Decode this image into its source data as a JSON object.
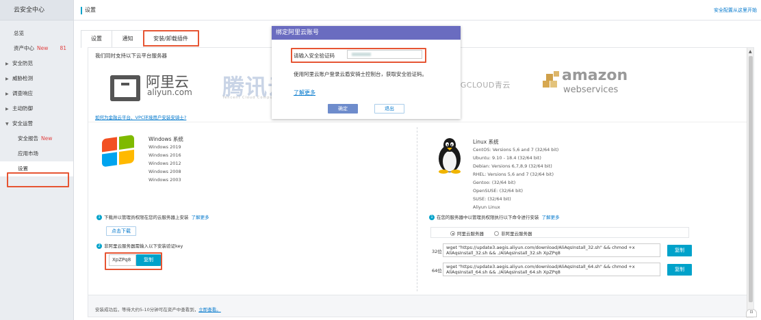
{
  "sidebar": {
    "brand": "云安全中心",
    "items": [
      {
        "label": "总览"
      },
      {
        "label": "资产中心",
        "badge": "New",
        "count": "81"
      },
      {
        "label": "安全防范",
        "group": true
      },
      {
        "label": "威胁检测",
        "group": true
      },
      {
        "label": "调查响应",
        "group": true
      },
      {
        "label": "主动防御",
        "group": true
      },
      {
        "label": "安全运营",
        "group": true,
        "expanded": true
      },
      {
        "label": "安全报告",
        "badge": "New",
        "sub": true
      },
      {
        "label": "应用市场",
        "sub": true
      },
      {
        "label": "设置",
        "sub": true,
        "active": true
      }
    ]
  },
  "topbar": {
    "title": "设置",
    "link": "安全配置从这里开始"
  },
  "tabs": [
    {
      "label": "设置"
    },
    {
      "label": "通知"
    },
    {
      "label": "安装/卸载插件",
      "active": true
    }
  ],
  "main": {
    "support_text": "我们同时支持以下云平台服务器",
    "logos": {
      "aliyun_cn": "阿里云",
      "aliyun_en": "aliyun.com",
      "tencent_cn": "腾讯云",
      "tencent_en": "Tencent Cloud Compu",
      "kingsoft": "IGCLOUD青云",
      "amazon": "amazon",
      "aws": "webservices"
    },
    "finance_link": "如何为金融云平台、VPC环境用户安装安骑士?",
    "windows": {
      "title": "Windows 系统",
      "versions": [
        "Windows 2019",
        "Windows 2016",
        "Windows 2012",
        "Windows 2008",
        "Windows 2003"
      ],
      "step1_text": "下载并以管理员权限在您的云服务器上安装",
      "step1_link": "了解更多",
      "download_btn": "点击下载",
      "step2_text": "非阿里云服务器需输入以下安装验证key",
      "key_value": "XpZPq8",
      "copy_btn": "复制"
    },
    "linux": {
      "title": "Linux 系统",
      "versions": [
        "CentOS: Versions 5,6 and 7 (32/64 bit)",
        "Ubuntu: 9.10 - 18.4 (32/64 bit)",
        "Debian: Versions 6,7,8,9 (32/64 bit)",
        "RHEL: Versions 5,6 and 7 (32/64 bit)",
        "Gentoo: (32/64 bit)",
        "OpenSUSE: (32/64 bit)",
        "SUSE: (32/64 bit)",
        "Aliyun Linux"
      ],
      "step1_text": "在您的服务器中以管理员权限执行以下命令进行安装",
      "step1_link": "了解更多",
      "radio_ali": "阿里云服务器",
      "radio_nonali": "非阿里云服务器",
      "label32": "32位",
      "cmd32": "wget \"https://update3.aegis.aliyun.com/download/AliAqsInstall_32.sh\" && chmod +x AliAqsInstall_32.sh && ./AliAqsInstall_32.sh XpZPq8",
      "label64": "64位",
      "cmd64": "wget \"https://update3.aegis.aliyun.com/download/AliAqsInstall_64.sh\" && chmod +x AliAqsInstall_64.sh && ./AliAqsInstall_64.sh XpZPq8",
      "copy_btn": "复制"
    },
    "bottom_tip_prefix": "安装成功后，等待大约5-10分钟可在资产中查看到，",
    "bottom_tip_link": "立即查看。"
  },
  "modal": {
    "title": "绑定阿里云账号",
    "code_label": "请输入安全验证码",
    "description": "使用阿里云账户登录云盾安骑士控制台，获取安全验证码。",
    "more_link": "了解更多",
    "ok_btn": "确定",
    "quit_btn": "退出"
  },
  "colors": {
    "accent": "#00a2ca",
    "highlight": "#e65432",
    "modal_header": "#6a6cc0",
    "link": "#0077cc"
  }
}
